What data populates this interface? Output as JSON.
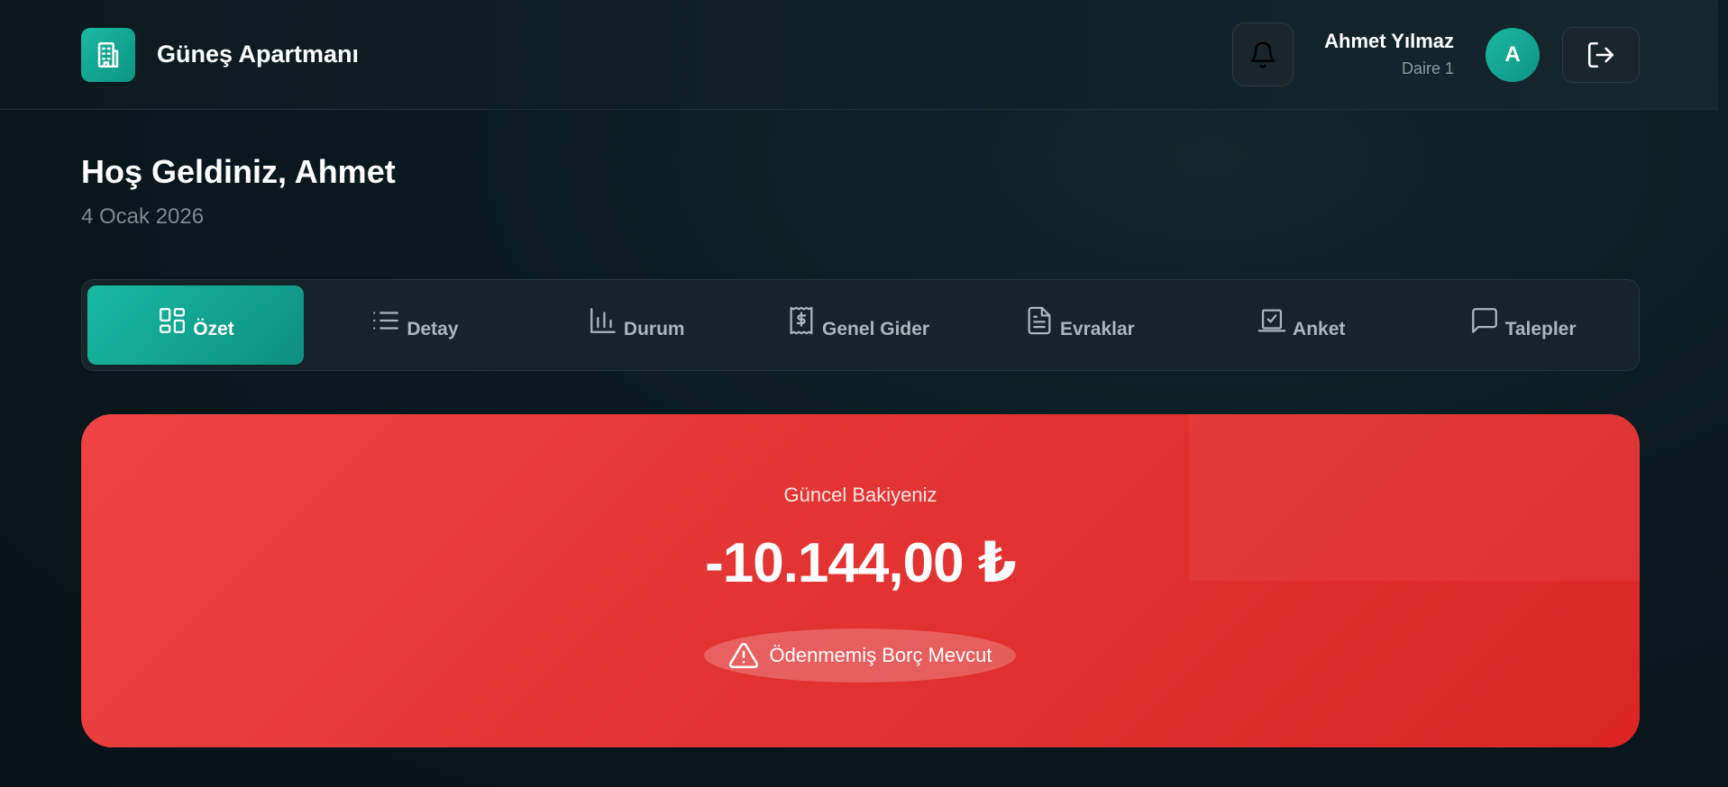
{
  "header": {
    "brand_title": "Güneş Apartmanı",
    "user_name": "Ahmet Yılmaz",
    "user_unit": "Daire 1",
    "avatar_initial": "A"
  },
  "welcome": {
    "title": "Hoş Geldiniz, Ahmet",
    "date": "4 Ocak 2026"
  },
  "tabs": [
    {
      "label": "Özet",
      "icon": "dashboard-icon",
      "active": true
    },
    {
      "label": "Detay",
      "icon": "list-icon",
      "active": false
    },
    {
      "label": "Durum",
      "icon": "bar-chart-icon",
      "active": false
    },
    {
      "label": "Genel Gider",
      "icon": "receipt-icon",
      "active": false
    },
    {
      "label": "Evraklar",
      "icon": "document-icon",
      "active": false
    },
    {
      "label": "Anket",
      "icon": "vote-icon",
      "active": false
    },
    {
      "label": "Talepler",
      "icon": "message-icon",
      "active": false
    }
  ],
  "balance": {
    "label": "Güncel Bakiyeniz",
    "amount": "-10.144,00 ₺",
    "status": "Ödenmemiş Borç Mevcut"
  },
  "colors": {
    "accent": "#14b8a6",
    "danger": "#dc2626",
    "background": "#0a1a20"
  }
}
